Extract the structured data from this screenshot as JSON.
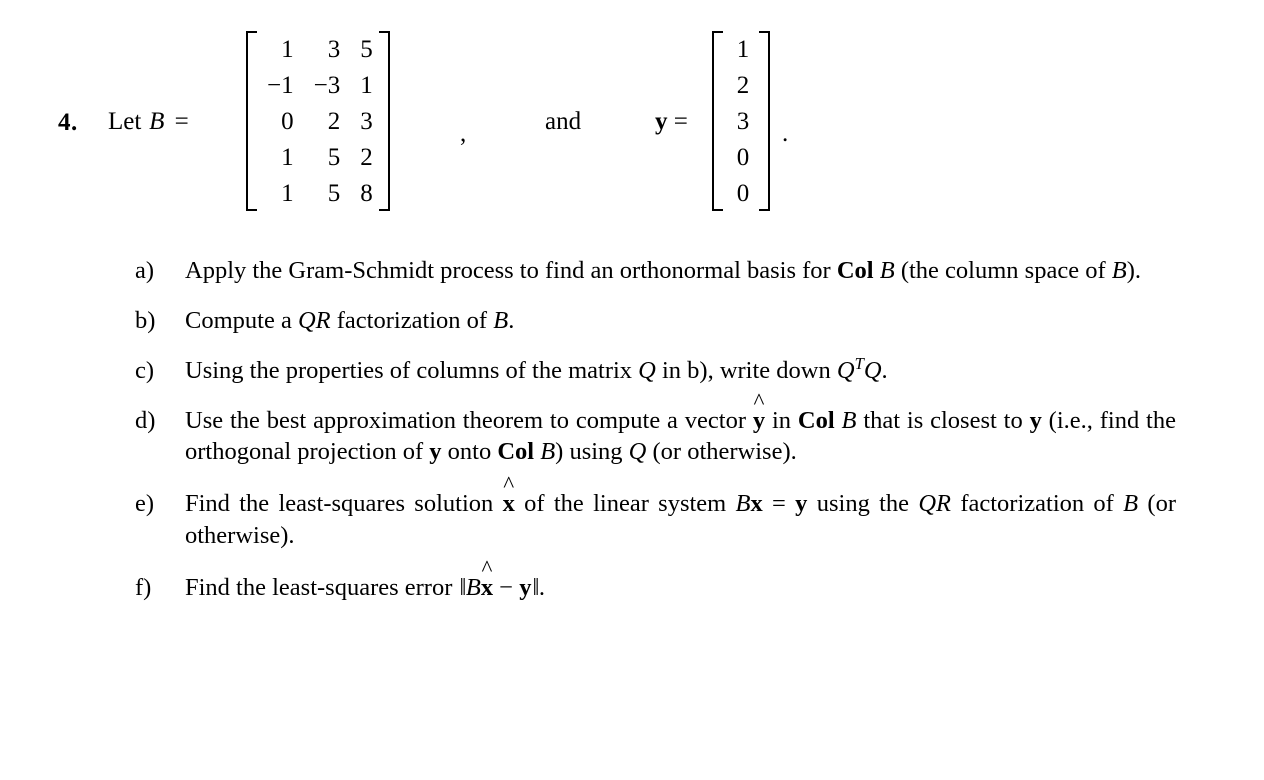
{
  "problem": {
    "number": "4.",
    "let_text": "Let",
    "matrix_name": "B",
    "equals": "=",
    "comma": ",",
    "and_word": "and",
    "vector_name": "y",
    "period": "."
  },
  "matrix_B": {
    "name": "B",
    "rows": 5,
    "cols": 3,
    "values": [
      [
        "1",
        "3",
        "5"
      ],
      [
        "−1",
        "−3",
        "1"
      ],
      [
        "0",
        "2",
        "3"
      ],
      [
        "1",
        "5",
        "2"
      ],
      [
        "1",
        "5",
        "8"
      ]
    ]
  },
  "vector_y": {
    "name": "y",
    "rows": 5,
    "cols": 1,
    "values": [
      "1",
      "2",
      "3",
      "0",
      "0"
    ]
  },
  "parts": [
    {
      "label": "a)",
      "text": "Apply the Gram-Schmidt process to find an orthonormal basis for Col B (the column space of B)."
    },
    {
      "label": "b)",
      "text": "Compute a QR factorization of B."
    },
    {
      "label": "c)",
      "text": "Using the properties of columns of the matrix Q in b), write down Q^T Q."
    },
    {
      "label": "d)",
      "text": "Use the best approximation theorem to compute a vector y-hat in Col B that is closest to y (i.e., find the orthogonal projection of y onto Col B) using Q (or otherwise)."
    },
    {
      "label": "e)",
      "text": "Find the least-squares solution x-hat of the linear system Bx = y using the QR factorization of B (or otherwise)."
    },
    {
      "label": "f)",
      "text": "Find the least-squares error ||B x-hat − y||."
    }
  ],
  "glyphs": {
    "hat": "^",
    "minus": "−",
    "double_bar": "‖",
    "superscript_T": "T"
  },
  "colors": {
    "text": "#000000",
    "background": "#ffffff"
  }
}
